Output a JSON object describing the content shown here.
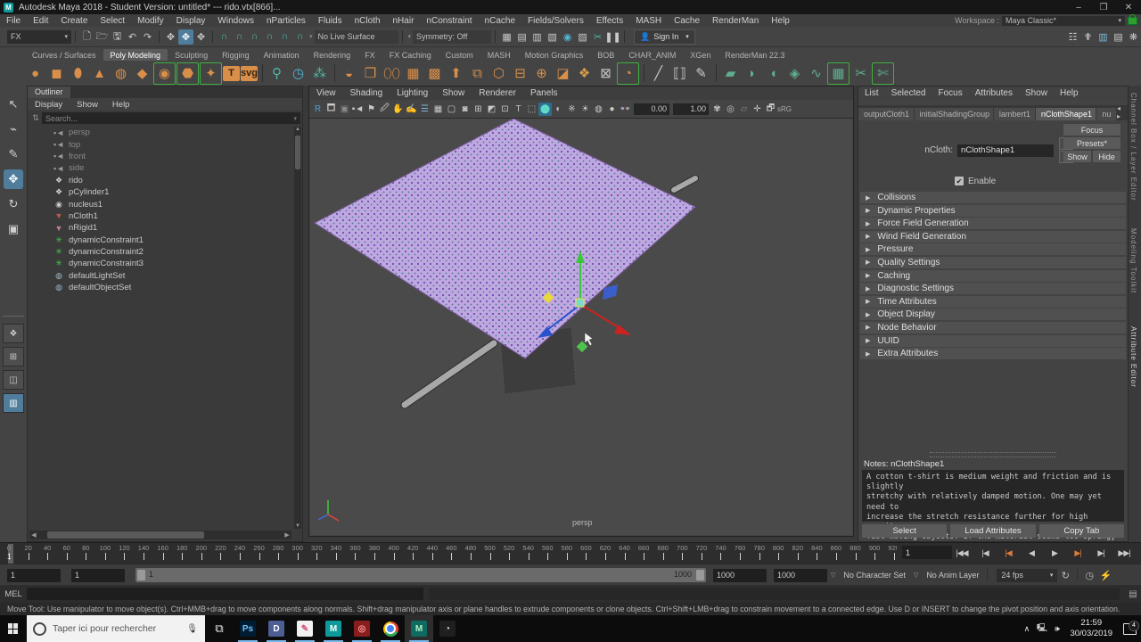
{
  "title_bar": {
    "title": "Autodesk Maya 2018 - Student Version: untitled*   ---   rido.vtx[866]...",
    "minimize": "–",
    "maximize": "❐",
    "close": "✕",
    "logo_letter": "M"
  },
  "menu_bar": {
    "items": [
      "File",
      "Edit",
      "Create",
      "Select",
      "Modify",
      "Display",
      "Windows",
      "nParticles",
      "Fluids",
      "nCloth",
      "nHair",
      "nConstraint",
      "nCache",
      "Fields/Solvers",
      "Effects",
      "MASH",
      "Cache",
      "RenderMan",
      "Help"
    ],
    "workspace_label": "Workspace :",
    "workspace_value": "Maya Classic*"
  },
  "status_line": {
    "mode_value": "FX",
    "live_surface": "No Live Surface",
    "symmetry": "Symmetry: Off",
    "sign_in": "Sign In",
    "left_icons": [
      {
        "n": "new-scene-icon",
        "g": "🗋",
        "c": "#c9c9c9"
      },
      {
        "n": "open-scene-icon",
        "g": "🗁",
        "c": "#c9c9c9"
      },
      {
        "n": "save-scene-icon",
        "g": "🖫",
        "c": "#c9c9c9"
      },
      {
        "n": "undo-icon",
        "g": "↶",
        "c": "#c9c9c9"
      },
      {
        "n": "redo-icon",
        "g": "↷",
        "c": "#c9c9c9"
      }
    ],
    "select-icons": [
      {
        "n": "select-hierarchy-icon",
        "g": "✥",
        "c": "#c9c9c9",
        "hl": false
      },
      {
        "n": "select-object-icon",
        "g": "✥",
        "c": "#fff",
        "hl": true
      },
      {
        "n": "select-component-icon",
        "g": "✥",
        "c": "#c9c9c9",
        "hl": false
      }
    ],
    "snap_icons": [
      {
        "n": "snap-grid-icon",
        "g": "∩",
        "c": "#4fb8a8"
      },
      {
        "n": "snap-curve-icon",
        "g": "∩",
        "c": "#4fb8a8"
      },
      {
        "n": "snap-point-icon",
        "g": "∩",
        "c": "#4fb8a8"
      },
      {
        "n": "snap-projected-icon",
        "g": "∩",
        "c": "#4fb8a8"
      },
      {
        "n": "snap-view-icon",
        "g": "∩",
        "c": "#4fb8a8"
      },
      {
        "n": "snap-live-icon",
        "g": "∩",
        "c": "#4fb8a8"
      }
    ],
    "render_icons": [
      {
        "n": "render-view-icon",
        "g": "▦",
        "c": "#c9c9c9"
      },
      {
        "n": "render-current-icon",
        "g": "▤",
        "c": "#c9c9c9"
      },
      {
        "n": "ipr-render-icon",
        "g": "▥",
        "c": "#c9c9c9"
      },
      {
        "n": "render-settings-icon",
        "g": "▧",
        "c": "#c9c9c9"
      },
      {
        "n": "hypershade-icon",
        "g": "◉",
        "c": "#4fb8d8"
      },
      {
        "n": "light-editor-icon",
        "g": "▨",
        "c": "#c9c9c9"
      },
      {
        "n": "paint-effects-icon",
        "g": "✂",
        "c": "#4fb8a8"
      },
      {
        "n": "pause-icon",
        "g": "❚❚",
        "c": "#c9c9c9"
      }
    ],
    "right_icons": [
      {
        "n": "show-manipulator-icon",
        "g": "☷",
        "c": "#c9c9c9"
      },
      {
        "n": "character-icon",
        "g": "✟",
        "c": "#c9c9c9"
      },
      {
        "n": "channelbox-toggle-icon",
        "g": "▥",
        "c": "#7fb8d8"
      },
      {
        "n": "attreditor-toggle-icon",
        "g": "▤",
        "c": "#c9c9c9"
      },
      {
        "n": "toolsettings-toggle-icon",
        "g": "❋",
        "c": "#c9c9c9"
      }
    ]
  },
  "shelf": {
    "tabs": [
      "Curves / Surfaces",
      "Poly Modeling",
      "Sculpting",
      "Rigging",
      "Animation",
      "Rendering",
      "FX",
      "FX Caching",
      "Custom",
      "MASH",
      "Motion Graphics",
      "BOB",
      "CHAR_ANIM",
      "XGen",
      "RenderMan 22.3"
    ],
    "active_tab": "Poly Modeling",
    "icons": [
      {
        "n": "poly-sphere-icon",
        "g": "●",
        "c": "#d98f4a"
      },
      {
        "n": "poly-cube-icon",
        "g": "◼",
        "c": "#d98f4a"
      },
      {
        "n": "poly-cylinder-icon",
        "g": "⬮",
        "c": "#d98f4a"
      },
      {
        "n": "poly-cone-icon",
        "g": "▲",
        "c": "#d98f4a"
      },
      {
        "n": "poly-torus-icon",
        "g": "◍",
        "c": "#d98f4a"
      },
      {
        "n": "poly-pyramid-icon",
        "g": "◆",
        "c": "#d98f4a"
      },
      {
        "n": "poly-disc-icon",
        "g": "◉",
        "c": "#d98f4a",
        "br": true
      },
      {
        "n": "platonic-solid-icon",
        "g": "⬣",
        "c": "#d98f4a",
        "br": true
      },
      {
        "n": "super-shape-icon",
        "g": "✦",
        "c": "#d98f4a",
        "br": true
      },
      {
        "n": "poly-text-icon",
        "g": "T",
        "c": "#d98f4a"
      },
      {
        "n": "svg-icon",
        "g": "svg",
        "c": "#d98f4a"
      },
      {
        "n": "sep",
        "g": "",
        "c": ""
      },
      {
        "n": "curve-warp-icon",
        "g": "⚲",
        "c": "#4fb8a8"
      },
      {
        "n": "sweep-mesh-icon",
        "g": "◷",
        "c": "#4fb8d8"
      },
      {
        "n": "type-zero-icon",
        "g": "⁂",
        "c": "#4fb8a8"
      },
      {
        "n": "sep",
        "g": "",
        "c": ""
      },
      {
        "n": "combine-icon",
        "g": "◒",
        "c": "#d98f4a"
      },
      {
        "n": "separate-icon",
        "g": "❒",
        "c": "#d98f4a"
      },
      {
        "n": "boolean-icon",
        "g": "⬯⬯",
        "c": "#d98f4a"
      },
      {
        "n": "smooth-icon",
        "g": "▦",
        "c": "#d98f4a"
      },
      {
        "n": "reduce-icon",
        "g": "▩",
        "c": "#d98f4a"
      },
      {
        "n": "extrude-icon",
        "g": "⬆",
        "c": "#d98f4a"
      },
      {
        "n": "mirror-icon",
        "g": "⧉",
        "c": "#d98f4a"
      },
      {
        "n": "remesh-icon",
        "g": "⬡",
        "c": "#d98f4a"
      },
      {
        "n": "retopo-icon",
        "g": "⊟",
        "c": "#d98f4a"
      },
      {
        "n": "circularize-icon",
        "g": "⊕",
        "c": "#d98f4a"
      },
      {
        "n": "flip-icon",
        "g": "◪",
        "c": "#d98f4a"
      },
      {
        "n": "spin-edge-icon",
        "g": "❖",
        "c": "#d9a04a"
      },
      {
        "n": "project-curve-icon",
        "g": "⊠",
        "c": "#c9c9c9"
      },
      {
        "n": "make-live-icon",
        "g": "◔",
        "c": "#d98f4a",
        "br": true
      },
      {
        "n": "sep",
        "g": "",
        "c": ""
      },
      {
        "n": "knife-icon",
        "g": "╱",
        "c": "#c9c9c9"
      },
      {
        "n": "bridge-icon",
        "g": "⟦⟧",
        "c": "#c9c9c9"
      },
      {
        "n": "quad-draw-icon",
        "g": "✎",
        "c": "#c9c9c9"
      },
      {
        "n": "sep",
        "g": "",
        "c": ""
      },
      {
        "n": "uv-fill-icon",
        "g": "▰",
        "c": "#5faf8f"
      },
      {
        "n": "uv-shell-icon",
        "g": "◗",
        "c": "#5faf8f"
      },
      {
        "n": "uv-cut-icon",
        "g": "◖",
        "c": "#5faf8f"
      },
      {
        "n": "uv-unfold-icon",
        "g": "◈",
        "c": "#5faf8f"
      },
      {
        "n": "uv-snake-icon",
        "g": "∿",
        "c": "#5faf8f"
      },
      {
        "n": "uv-editor-icon",
        "g": "▦",
        "c": "#5faf8f",
        "br": true
      },
      {
        "n": "uv-sew-icon",
        "g": "✂",
        "c": "#5faf8f"
      },
      {
        "n": "uv-cutsew-icon",
        "g": "✄",
        "c": "#5faf8f",
        "br": true
      }
    ]
  },
  "toolbox": {
    "tools": [
      {
        "n": "select-tool",
        "g": "↖",
        "active": false
      },
      {
        "n": "lasso-tool",
        "g": "⌁",
        "active": false
      },
      {
        "n": "paint-select-tool",
        "g": "✎",
        "active": false
      },
      {
        "n": "move-tool",
        "g": "✥",
        "active": true
      },
      {
        "n": "rotate-tool",
        "g": "↻",
        "active": false
      },
      {
        "n": "scale-tool",
        "g": "▣",
        "active": false
      }
    ],
    "layouts": [
      {
        "n": "layout-single",
        "g": "❖",
        "active": false
      },
      {
        "n": "layout-four",
        "g": "⊞",
        "active": false
      },
      {
        "n": "layout-two-side",
        "g": "◫",
        "active": false
      },
      {
        "n": "layout-outliner-persp",
        "g": "▥",
        "active": true
      }
    ]
  },
  "outliner": {
    "tab": "Outliner",
    "menus": [
      "Display",
      "Show",
      "Help"
    ],
    "search_placeholder": "Search...",
    "items": [
      {
        "label": "persp",
        "type": "camera",
        "dim": true
      },
      {
        "label": "top",
        "type": "camera",
        "dim": true
      },
      {
        "label": "front",
        "type": "camera",
        "dim": true
      },
      {
        "label": "side",
        "type": "camera",
        "dim": true
      },
      {
        "label": "rido",
        "type": "transform",
        "dim": false
      },
      {
        "label": "pCylinder1",
        "type": "transform",
        "dim": false
      },
      {
        "label": "nucleus1",
        "type": "nucleus",
        "dim": false
      },
      {
        "label": "nCloth1",
        "type": "ncloth",
        "dim": false
      },
      {
        "label": "nRigid1",
        "type": "nrigid",
        "dim": false
      },
      {
        "label": "dynamicConstraint1",
        "type": "constraint",
        "dim": false
      },
      {
        "label": "dynamicConstraint2",
        "type": "constraint",
        "dim": false
      },
      {
        "label": "dynamicConstraint3",
        "type": "constraint",
        "dim": false
      },
      {
        "label": "defaultLightSet",
        "type": "set",
        "dim": false
      },
      {
        "label": "defaultObjectSet",
        "type": "set",
        "dim": false
      }
    ]
  },
  "viewport": {
    "menus": [
      "View",
      "Shading",
      "Lighting",
      "Show",
      "Renderer",
      "Panels"
    ],
    "exposure": "0.00",
    "gamma": "1.00",
    "view_transform": "sRG",
    "camera_label": "persp",
    "toolbar_icons": [
      {
        "n": "renderer-icon",
        "g": "R",
        "c": "#4f9fd8",
        "hl": false
      },
      {
        "n": "select-camera-icon",
        "g": "🗖",
        "c": "#c9c9c9",
        "hl": false
      },
      {
        "n": "lock-camera-icon",
        "g": "▣",
        "c": "#8a8a8a",
        "hl": false
      },
      {
        "n": "camera-attr-icon",
        "g": "▪◄",
        "c": "#c9c9c9",
        "hl": false
      },
      {
        "n": "bookmark-icon",
        "g": "⚑",
        "c": "#c9c9c9",
        "hl": false
      },
      {
        "n": "image-plane-icon",
        "g": "🖉",
        "c": "#c9c9c9",
        "hl": false
      },
      {
        "n": "2d-pan-icon",
        "g": "✋",
        "c": "#c9c9c9",
        "hl": false
      },
      {
        "n": "oscillate-icon",
        "g": "✍",
        "c": "#c9c9c9",
        "hl": false
      },
      {
        "n": "grease-pencil-icon",
        "g": "☰",
        "c": "#7fb8d8",
        "hl": false
      },
      {
        "n": "grid-icon",
        "g": "▦",
        "c": "#c9c9c9",
        "hl": false
      },
      {
        "n": "film-gate-icon",
        "g": "▢",
        "c": "#c9c9c9",
        "hl": false
      },
      {
        "n": "resolution-gate-icon",
        "g": "◙",
        "c": "#c9c9c9",
        "hl": false
      },
      {
        "n": "gate-mask-icon",
        "g": "⊞",
        "c": "#c9c9c9",
        "hl": false
      },
      {
        "n": "field-chart-icon",
        "g": "◩",
        "c": "#c9c9c9",
        "hl": false
      },
      {
        "n": "safe-action-icon",
        "g": "⊡",
        "c": "#c9c9c9",
        "hl": false
      },
      {
        "n": "safe-title-icon",
        "g": "T",
        "c": "#c9c9c9",
        "hl": false
      },
      {
        "n": "wireframe-icon",
        "g": "⬚",
        "c": "#c9c9c9",
        "hl": false
      },
      {
        "n": "shaded-icon",
        "g": "⬤",
        "c": "#5fd8c8",
        "hl": true
      },
      {
        "n": "textured-icon",
        "g": "◐",
        "c": "#c9c9c9",
        "hl": false
      },
      {
        "n": "lights-icon",
        "g": "※",
        "c": "#c9c9c9",
        "hl": false
      },
      {
        "n": "shadows-icon",
        "g": "☀",
        "c": "#c9c9c9",
        "hl": false
      },
      {
        "n": "ao-icon",
        "g": "◍",
        "c": "#c9c9c9",
        "hl": false
      },
      {
        "n": "aa-icon",
        "g": "●",
        "c": "#c9c9c9",
        "hl": false
      },
      {
        "n": "xray-icon",
        "g": "👓",
        "c": "#c9c9c9",
        "hl": false
      },
      {
        "n": "joints-xray-icon",
        "g": "✾",
        "c": "#c9c9c9",
        "hl": false
      },
      {
        "n": "isolate-icon",
        "g": "◎",
        "c": "#c9c9c9",
        "hl": false
      },
      {
        "n": "plugin-icon",
        "g": "▱",
        "c": "#8a8a8a",
        "hl": false
      },
      {
        "n": "sel-highlight-icon",
        "g": "✛",
        "c": "#c9c9c9",
        "hl": false
      },
      {
        "n": "exposure-icon",
        "g": "🗗",
        "c": "#c9c9c9",
        "hl": false
      }
    ]
  },
  "attribute_editor": {
    "menus": [
      "List",
      "Selected",
      "Focus",
      "Attributes",
      "Show",
      "Help"
    ],
    "tabs": [
      "outputCloth1",
      "initialShadingGroup",
      "lambert1",
      "nClothShape1",
      "nu"
    ],
    "active_tab": "nClothShape1",
    "tab_arrows": "◂ ▸",
    "ncloth_label": "nCloth:",
    "ncloth_value": "nClothShape1",
    "focus_btn": "Focus",
    "presets_btn": "Presets*",
    "show_btn": "Show",
    "hide_btn": "Hide",
    "enable_label": "Enable",
    "check_glyph": "✔",
    "sections": [
      "Collisions",
      "Dynamic Properties",
      "Force Field Generation",
      "Wind Field Generation",
      "Pressure",
      "Quality Settings",
      "Caching",
      "Diagnostic Settings",
      "Time Attributes",
      "Object Display",
      "Node Behavior",
      "UUID",
      "Extra Attributes"
    ],
    "notes_title": "Notes: nClothShape1",
    "notes_text": "A cotton t-shirt is medium weight and friction and is slightly\nstretchy with relatively damped motion. One may yet need to\nincrease the stretch resistance further for high gravity or\nfast moving objects. If the material seems too springy try\nincreasing the damp value.",
    "footer_buttons": [
      "Select",
      "Load Attributes",
      "Copy Tab"
    ]
  },
  "right_strip": {
    "labels": [
      "Channel Box / Layer Editor",
      "Modeling Toolkit",
      "Attribute Editor"
    ]
  },
  "time_slider": {
    "tick_start": 0,
    "tick_end": 1000,
    "tick_step": 20,
    "current_frame": "1",
    "frame_field": "1",
    "playback": [
      {
        "n": "go-to-start-button",
        "g": "|◀◀",
        "orange": false
      },
      {
        "n": "step-back-frame-button",
        "g": "|◀",
        "orange": false
      },
      {
        "n": "step-back-key-button",
        "g": "|◀",
        "orange": true
      },
      {
        "n": "play-backwards-button",
        "g": "◀",
        "orange": false
      },
      {
        "n": "play-forwards-button",
        "g": "▶",
        "orange": false
      },
      {
        "n": "step-forward-key-button",
        "g": "▶|",
        "orange": true
      },
      {
        "n": "step-forward-frame-button",
        "g": "▶|",
        "orange": false
      },
      {
        "n": "go-to-end-button",
        "g": "▶▶|",
        "orange": false
      }
    ]
  },
  "range_slider": {
    "anim_start": "1",
    "playback_start": "1",
    "bar_start": "1",
    "bar_end": "1000",
    "playback_end": "1000",
    "anim_end": "1000",
    "character_set": "No Character Set",
    "anim_layer": "No Anim Layer",
    "fps": "24 fps",
    "loop_glyph": "↻",
    "clock_glyph": "◷",
    "autokey_glyph": "⚡"
  },
  "command_line": {
    "label": "MEL"
  },
  "help_line": {
    "text": "Move Tool: Use manipulator to move object(s). Ctrl+MMB+drag to move components along normals. Shift+drag manipulator axis or plane handles to extrude components or clone objects. Ctrl+Shift+LMB+drag to constrain movement to a connected edge. Use D or INSERT to change the pivot position and axis orientation."
  },
  "taskbar": {
    "search_placeholder": "Taper ici pour rechercher",
    "time": "21:59",
    "date": "30/03/2019",
    "notification_count": "4",
    "apps": [
      {
        "n": "task-view-button",
        "kind": "glyph",
        "g": "⧉",
        "bg": "",
        "fg": "#e8e8e8",
        "running": false,
        "active": false
      },
      {
        "n": "photoshop-app",
        "kind": "box",
        "g": "Ps",
        "bg": "#001d33",
        "fg": "#6fc3f7",
        "running": true,
        "active": false
      },
      {
        "n": "discord-app",
        "kind": "box",
        "g": "D",
        "bg": "#4e5d94",
        "fg": "#ffffff",
        "running": true,
        "active": false
      },
      {
        "n": "medibang-app",
        "kind": "box",
        "g": "✎",
        "bg": "#f2f2f2",
        "fg": "#d8567a",
        "running": true,
        "active": false
      },
      {
        "n": "maya-teal-app",
        "kind": "box",
        "g": "M",
        "bg": "#0e9a9a",
        "fg": "#ffffff",
        "running": true,
        "active": false
      },
      {
        "n": "raptr-app",
        "kind": "box",
        "g": "◎",
        "bg": "#8a1d1d",
        "fg": "#ff9a9a",
        "running": true,
        "active": false
      },
      {
        "n": "chrome-app",
        "kind": "chrome",
        "g": "",
        "bg": "",
        "fg": "",
        "running": true,
        "active": false
      },
      {
        "n": "maya-active-app",
        "kind": "box",
        "g": "M",
        "bg": "#0f6b5f",
        "fg": "#aef0c8",
        "running": true,
        "active": true
      },
      {
        "n": "obs-app",
        "kind": "box",
        "g": "◔",
        "bg": "#1f1f1f",
        "fg": "#e8e8e8",
        "running": false,
        "active": false
      }
    ]
  },
  "colors": {
    "accent_blue": "#4f7d9b",
    "cloth_fill": "#bfa8e0",
    "cloth_dot": "#6a4fae",
    "axis_x": "#cc2222",
    "axis_y": "#3cc43c",
    "axis_z": "#2952cc",
    "manip_yellow": "#e8d83c",
    "orange": "#e07b39"
  }
}
